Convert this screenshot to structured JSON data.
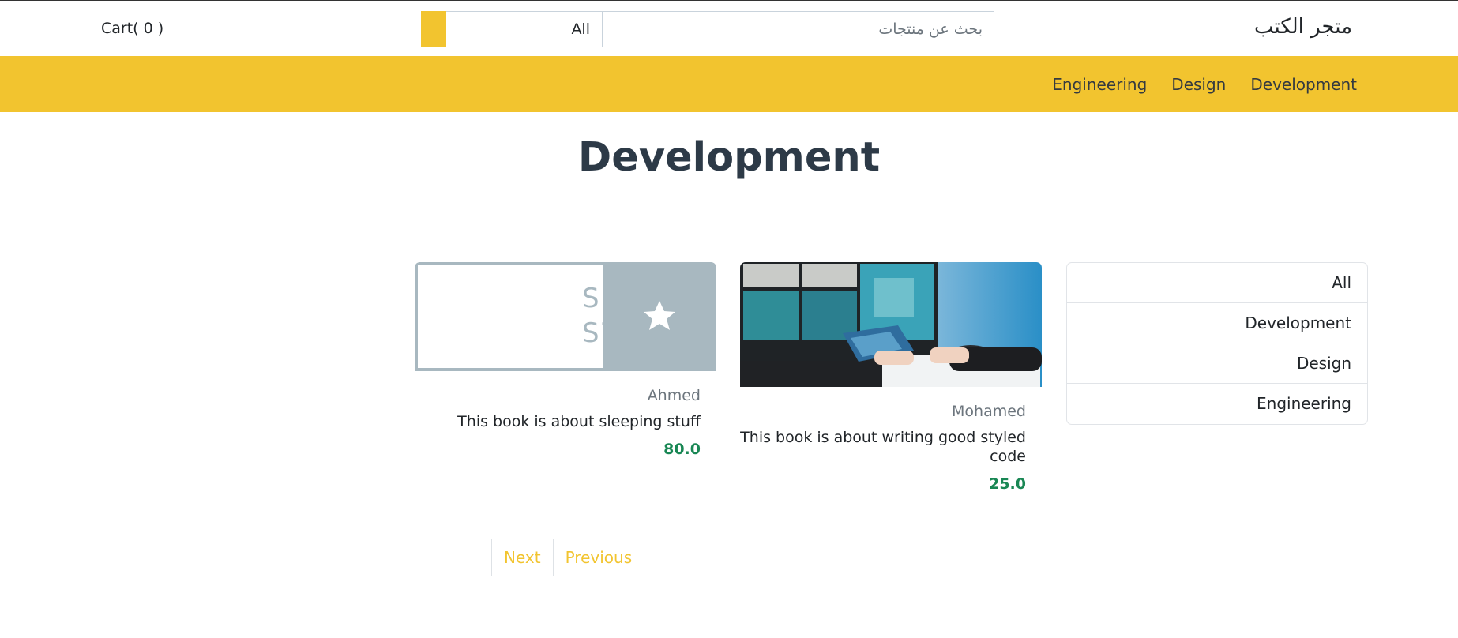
{
  "header": {
    "brand": "متجر الكتب",
    "cart_label": "Cart",
    "cart_count": "( 0 )",
    "search_placeholder": "بحث عن منتجات",
    "search_category": "All"
  },
  "nav": {
    "items": [
      {
        "label": "Development"
      },
      {
        "label": "Design"
      },
      {
        "label": "Engineering"
      }
    ]
  },
  "page": {
    "title": "Development"
  },
  "categories": [
    {
      "label": "All"
    },
    {
      "label": "Development"
    },
    {
      "label": "Design"
    },
    {
      "label": "Engineering"
    }
  ],
  "products": [
    {
      "author": "Ahmed",
      "description": "This book is about sleeping stuff",
      "price": "80.0",
      "image_text_line1": "SIMPLE",
      "image_text_line2": "STAR"
    },
    {
      "author": "Mohamed",
      "description": "This book is about writing good styled code",
      "price": "25.0"
    }
  ],
  "pagination": {
    "next_label": "Next",
    "previous_label": "Previous"
  },
  "colors": {
    "accent": "#f2c42f",
    "price": "#198754",
    "title": "#2d3a47"
  }
}
